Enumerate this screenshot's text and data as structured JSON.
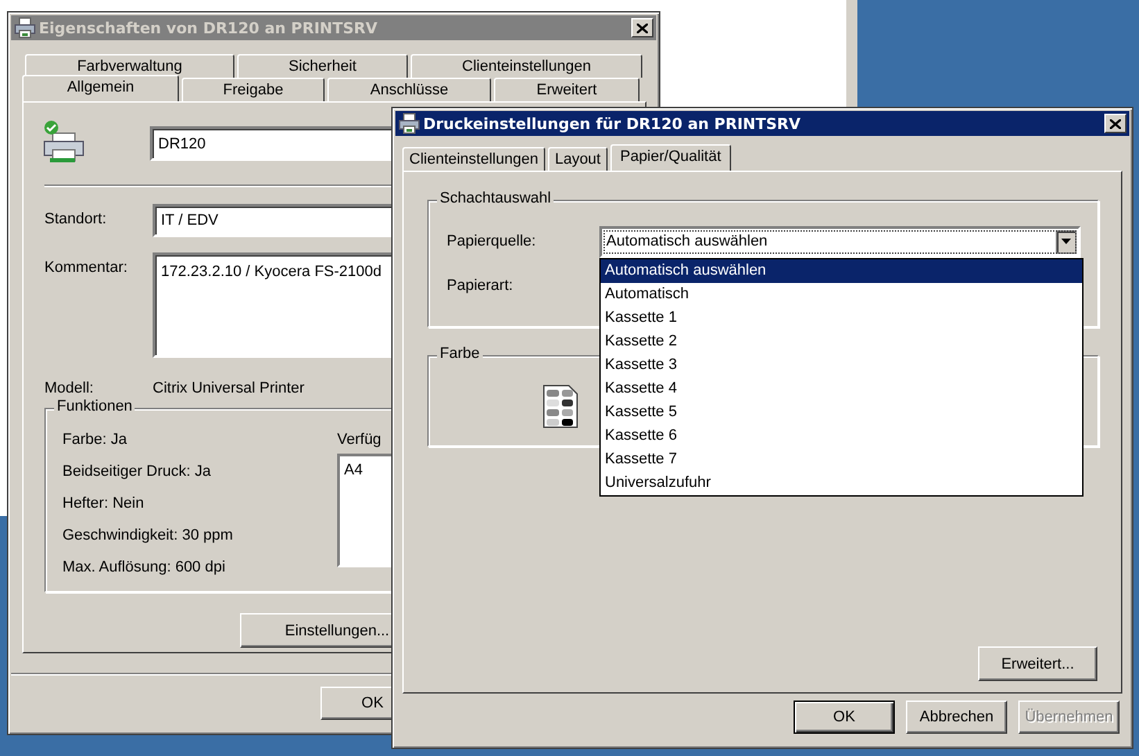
{
  "properties_dialog": {
    "title": "Eigenschaften von DR120 an PRINTSRV",
    "active": false,
    "tab_rows": [
      [
        {
          "label": "Farbverwaltung",
          "selected": false
        },
        {
          "label": "Sicherheit",
          "selected": false
        },
        {
          "label": "Clienteinstellungen",
          "selected": false
        }
      ],
      [
        {
          "label": "Allgemein",
          "selected": true
        },
        {
          "label": "Freigabe",
          "selected": false
        },
        {
          "label": "Anschlüsse",
          "selected": false
        },
        {
          "label": "Erweitert",
          "selected": false
        }
      ]
    ],
    "printer_name": "DR120",
    "location": {
      "label": "Standort:",
      "value": "IT / EDV"
    },
    "comment": {
      "label": "Kommentar:",
      "value": "172.23.2.10 / Kyocera FS-2100d"
    },
    "model": {
      "label": "Modell:",
      "value": "Citrix Universal Printer"
    },
    "features": {
      "title": "Funktionen",
      "items": [
        "Farbe: Ja",
        "Beidseitiger Druck: Ja",
        "Hefter: Nein",
        "Geschwindigkeit: 30 ppm",
        "Max. Auflösung: 600 dpi"
      ],
      "paper_label": "Verfüg",
      "paper_sizes": [
        "A4"
      ]
    },
    "settings_button": "Einstellungen...",
    "ok_button": "OK"
  },
  "preferences_dialog": {
    "title": "Druckeinstellungen für DR120 an PRINTSRV",
    "active": true,
    "tabs": [
      {
        "label": "Clienteinstellungen",
        "selected": false
      },
      {
        "label": "Layout",
        "selected": false
      },
      {
        "label": "Papier/Qualität",
        "selected": true
      }
    ],
    "tray_group": {
      "title": "Schachtauswahl",
      "paper_source": {
        "label": "Papierquelle:",
        "value": "Automatisch auswählen",
        "expanded": true,
        "options": [
          {
            "label": "Automatisch auswählen",
            "selected": true
          },
          {
            "label": "Automatisch",
            "selected": false
          },
          {
            "label": "Kassette 1",
            "selected": false
          },
          {
            "label": "Kassette 2",
            "selected": false
          },
          {
            "label": "Kassette 3",
            "selected": false
          },
          {
            "label": "Kassette 4",
            "selected": false
          },
          {
            "label": "Kassette 5",
            "selected": false
          },
          {
            "label": "Kassette 6",
            "selected": false
          },
          {
            "label": "Kassette 7",
            "selected": false
          },
          {
            "label": "Universalzufuhr",
            "selected": false
          }
        ]
      },
      "paper_type": {
        "label": "Papierart:"
      }
    },
    "color_group": {
      "title": "Farbe"
    },
    "advanced_button": "Erweitert...",
    "buttons": [
      {
        "label": "OK",
        "kind": "default",
        "disabled": false
      },
      {
        "label": "Abbrechen",
        "kind": "normal",
        "disabled": false
      },
      {
        "label": "Übernehmen",
        "kind": "normal",
        "disabled": true
      }
    ]
  }
}
